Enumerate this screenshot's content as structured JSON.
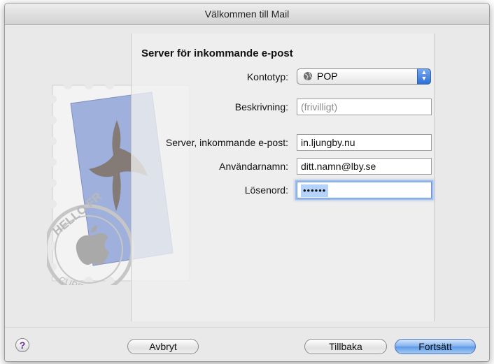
{
  "window": {
    "title": "Välkommen till Mail"
  },
  "stamp": {
    "text_top": "HELLO FR",
    "text_bottom": "CUPERTINO, CA"
  },
  "form": {
    "heading": "Server för inkommande e-post",
    "account_type": {
      "label": "Kontotyp:",
      "value": "POP",
      "icon": "globe-icon"
    },
    "description": {
      "label": "Beskrivning:",
      "placeholder": "(frivilligt)",
      "value": ""
    },
    "incoming_server": {
      "label": "Server, inkommande e-post:",
      "value": "in.ljungby.nu"
    },
    "username": {
      "label": "Användarnamn:",
      "value": "ditt.namn@lby.se"
    },
    "password": {
      "label": "Lösenord:",
      "value": "••••••"
    }
  },
  "footer": {
    "help": "?",
    "cancel": "Avbryt",
    "back": "Tillbaka",
    "continue": "Fortsätt"
  },
  "colors": {
    "focus": "#9cbdf0",
    "default_button": "#5c98e6",
    "help": "#6a2fa0"
  }
}
